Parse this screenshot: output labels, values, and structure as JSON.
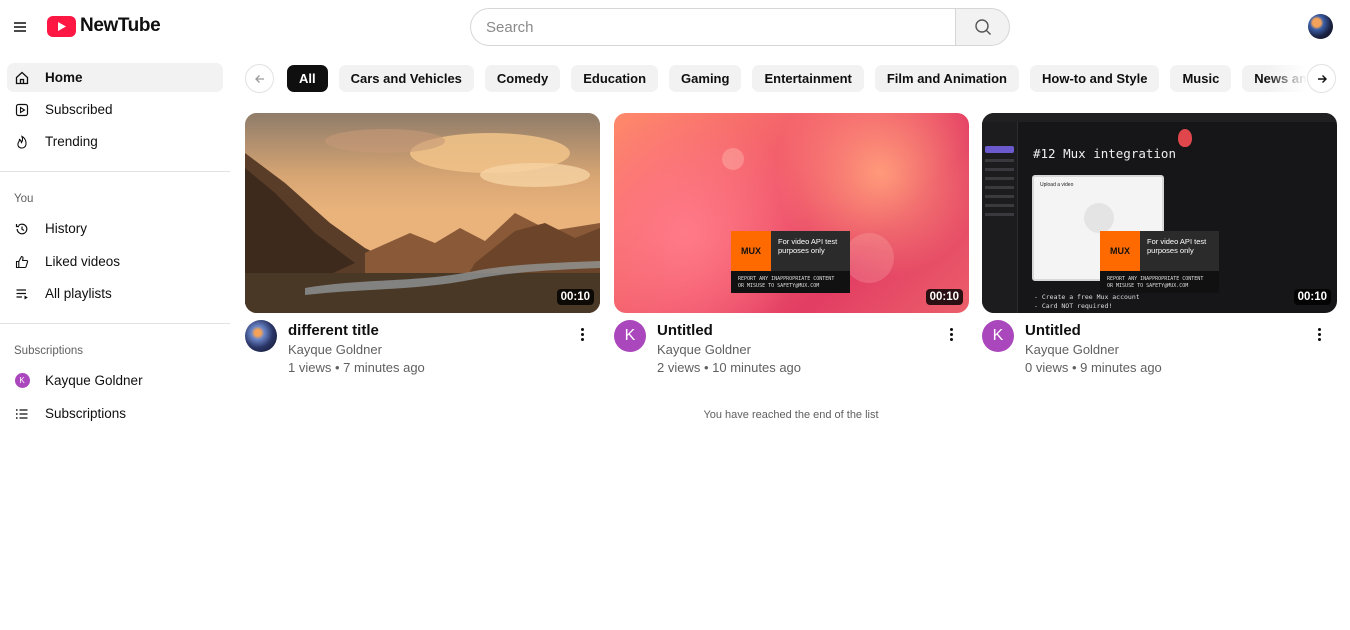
{
  "app": {
    "name": "NewTube"
  },
  "search": {
    "placeholder": "Search"
  },
  "sidebar": {
    "main": [
      {
        "label": "Home",
        "icon": "home-icon",
        "active": true
      },
      {
        "label": "Subscribed",
        "icon": "subscribed-icon"
      },
      {
        "label": "Trending",
        "icon": "flame-icon"
      }
    ],
    "you_label": "You",
    "you": [
      {
        "label": "History",
        "icon": "history-icon"
      },
      {
        "label": "Liked videos",
        "icon": "thumbs-up-icon"
      },
      {
        "label": "All playlists",
        "icon": "playlist-icon"
      }
    ],
    "subscriptions_label": "Subscriptions",
    "subscriptions": [
      {
        "label": "Kayque Goldner",
        "avatar_letter": "K"
      },
      {
        "label": "Subscriptions",
        "icon": "list-icon"
      }
    ]
  },
  "categories": [
    "All",
    "Cars and Vehicles",
    "Comedy",
    "Education",
    "Gaming",
    "Entertainment",
    "Film and Animation",
    "How-to and Style",
    "Music",
    "News and Politics"
  ],
  "videos": [
    {
      "title": "different title",
      "channel": "Kayque Goldner",
      "stats": "1 views • 7 minutes ago",
      "duration": "00:10",
      "avatar": "photo"
    },
    {
      "title": "Untitled",
      "channel": "Kayque Goldner",
      "stats": "2 views • 10 minutes ago",
      "duration": "00:10",
      "avatar_letter": "K"
    },
    {
      "title": "Untitled",
      "channel": "Kayque Goldner",
      "stats": "0 views • 9 minutes ago",
      "duration": "00:10",
      "avatar_letter": "K"
    }
  ],
  "thumb_text": {
    "mux_logo": "MUX",
    "mux_caption": "For video API test purposes only",
    "mux_report": "REPORT ANY INAPPROPRIATE CONTENT OR MISUSE TO SAFETY@MUX.COM",
    "mux_heading": "#12 Mux integration",
    "upload_title": "Upload a video",
    "mux_footer": "- Create a free Mux account\n- Card NOT required!"
  },
  "end_message": "You have reached the end of the list",
  "colors": {
    "brand": "#ff1744",
    "accent_avatar": "#ab47bc",
    "chip_active": "#0f0f0f"
  }
}
